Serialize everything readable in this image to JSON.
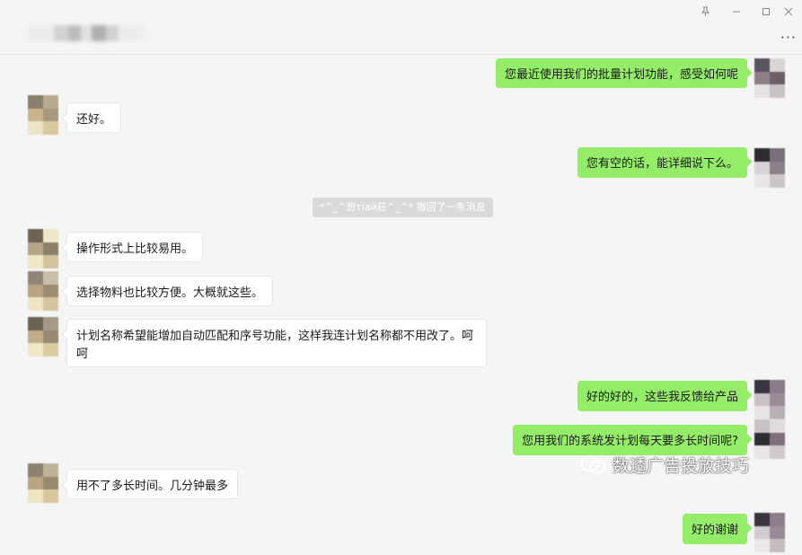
{
  "window": {
    "pin_icon": "pin-icon",
    "minimize_icon": "minimize-icon",
    "maximize_icon": "maximize-icon",
    "close_icon": "close-icon",
    "more_label": "···"
  },
  "messages": [
    {
      "side": "right",
      "text": "您最近使用我们的批量计划功能，感受如何呢"
    },
    {
      "side": "left",
      "text": "还好。"
    },
    {
      "side": "right",
      "text": "您有空的话，能详细说下么。"
    },
    {
      "side": "system",
      "text": "*^_^想тiaй莊^_^* 撤回了一条消息"
    },
    {
      "side": "left",
      "text": "操作形式上比较易用。"
    },
    {
      "side": "left",
      "text": "选择物料也比较方便。大概就这些。"
    },
    {
      "side": "left",
      "text": "计划名称希望能增加自动匹配和序号功能，这样我连计划名称都不用改了。呵呵"
    },
    {
      "side": "right",
      "text": "好的好的，这些我反馈给产品"
    },
    {
      "side": "right",
      "text": "您用我们的系统发计划每天要多长时间呢?"
    },
    {
      "side": "left",
      "text": "用不了多长时间。几分钟最多"
    },
    {
      "side": "right",
      "text": "好的谢谢"
    }
  ],
  "watermark": {
    "text": "数透广告投放技巧"
  },
  "colors": {
    "bubble_right": "#95ec69",
    "bubble_left": "#ffffff",
    "background": "#f5f5f5"
  }
}
